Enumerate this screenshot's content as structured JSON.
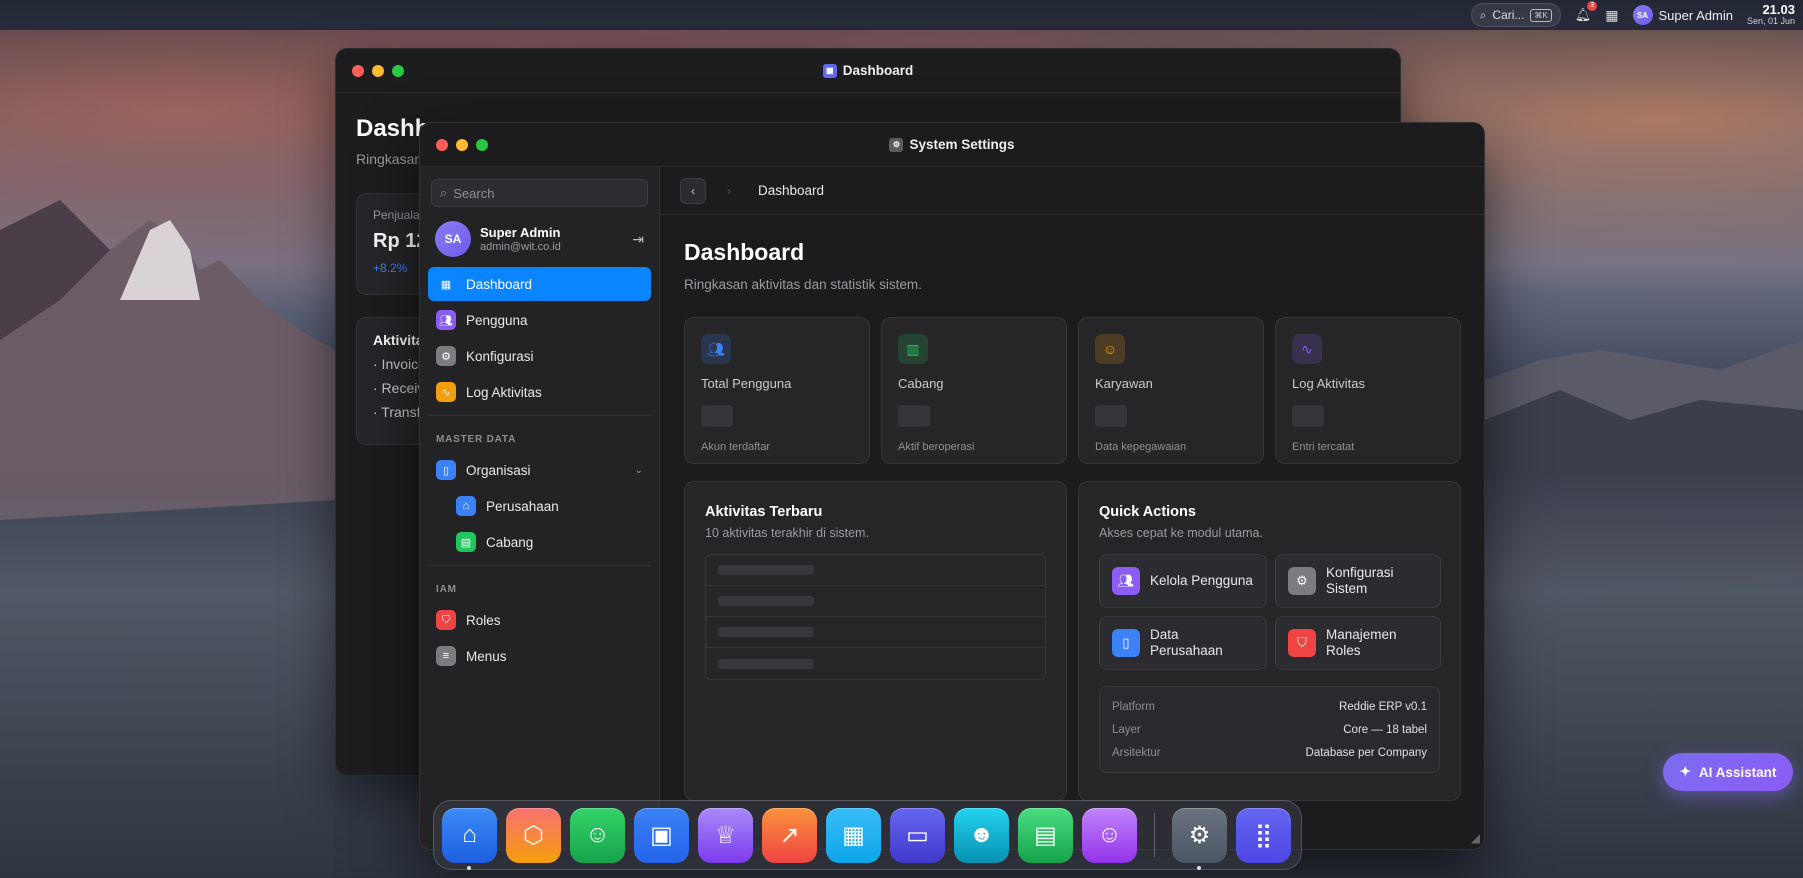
{
  "menubar": {
    "search_label": "Cari...",
    "search_shortcut": "⌘K",
    "notification_count": "3",
    "user_initials": "SA",
    "user_name": "Super Admin",
    "time": "21.03",
    "date": "Sen, 01 Jun"
  },
  "back_window": {
    "title": "Dashboard",
    "heading": "Dashb",
    "subtitle": "Ringkasan",
    "card1_label": "Penjuala",
    "card1_value": "Rp 12",
    "card1_change": "+8.2%",
    "card2_title": "Aktivita",
    "card2_lines": [
      "· Invoice",
      "· Receiv",
      "· Transf"
    ]
  },
  "front_window": {
    "title": "System Settings",
    "search_placeholder": "Search",
    "user": {
      "initials": "SA",
      "name": "Super Admin",
      "email": "admin@wit.co.id"
    },
    "nav_main": [
      {
        "label": "Dashboard",
        "icon": "grid-icon"
      },
      {
        "label": "Pengguna",
        "icon": "users-icon"
      },
      {
        "label": "Konfigurasi",
        "icon": "gear-icon"
      },
      {
        "label": "Log Aktivitas",
        "icon": "activity-icon"
      }
    ],
    "section_master": "MASTER DATA",
    "nav_master": [
      {
        "label": "Organisasi",
        "icon": "device-icon"
      },
      {
        "label": "Perusahaan",
        "icon": "building-icon"
      },
      {
        "label": "Cabang",
        "icon": "store-icon"
      }
    ],
    "section_iam": "IAM",
    "nav_iam": [
      {
        "label": "Roles",
        "icon": "shield-icon"
      },
      {
        "label": "Menus",
        "icon": "menu-icon"
      }
    ],
    "breadcrumb": "Dashboard",
    "page_title": "Dashboard",
    "page_subtitle": "Ringkasan aktivitas dan statistik sistem.",
    "stats": [
      {
        "label": "Total Pengguna",
        "footer": "Akun terdaftar",
        "color": "#3b82f6"
      },
      {
        "label": "Cabang",
        "footer": "Aktif beroperasi",
        "color": "#22c55e"
      },
      {
        "label": "Karyawan",
        "footer": "Data kepegawaian",
        "color": "#f59e0b"
      },
      {
        "label": "Log Aktivitas",
        "footer": "Entri tercatat",
        "color": "#8b5cf6"
      }
    ],
    "activity": {
      "title": "Aktivitas Terbaru",
      "subtitle": "10 aktivitas terakhir di sistem."
    },
    "quick": {
      "title": "Quick Actions",
      "subtitle": "Akses cepat ke modul utama.",
      "actions": [
        {
          "label": "Kelola Pengguna",
          "icon": "users-icon"
        },
        {
          "label": "Konfigurasi Sistem",
          "icon": "gear-icon"
        },
        {
          "label": "Data Perusahaan",
          "icon": "device-icon"
        },
        {
          "label": "Manajemen Roles",
          "icon": "shield-icon"
        }
      ],
      "info": [
        {
          "key": "Platform",
          "value": "Reddie ERP v0.1"
        },
        {
          "key": "Layer",
          "value": "Core — 18 tabel"
        },
        {
          "key": "Arsitektur",
          "value": "Database per Company"
        }
      ]
    }
  },
  "ai_assistant": {
    "label": "AI Assistant"
  },
  "dock": [
    "home-icon",
    "box-icon",
    "team-icon",
    "finance-icon",
    "trophy-icon",
    "trend-icon",
    "calendar-icon",
    "folder-icon",
    "people-icon",
    "briefcase-icon",
    "user-group-icon",
    "settings-icon",
    "apps-grid-icon"
  ]
}
